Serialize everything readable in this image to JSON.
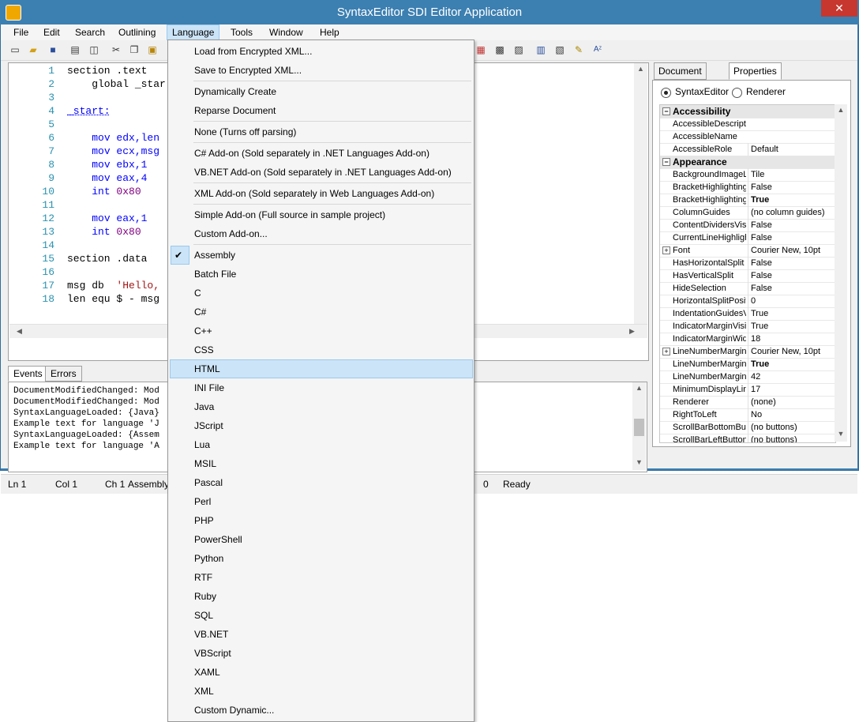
{
  "window": {
    "title": "SyntaxEditor SDI Editor Application",
    "close_glyph": "✕"
  },
  "menu": [
    "File",
    "Edit",
    "Search",
    "Outlining",
    "Language",
    "Tools",
    "Window",
    "Help"
  ],
  "code": {
    "line_numbers": [
      "1",
      "2",
      "3",
      "4",
      "5",
      "6",
      "7",
      "8",
      "9",
      "10",
      "11",
      "12",
      "13",
      "14",
      "15",
      "16",
      "17",
      "18"
    ],
    "lines": [
      {
        "t": "section .text",
        "c": ""
      },
      {
        "t": "    global _star",
        "c": ""
      },
      {
        "t": "",
        "c": ""
      },
      {
        "t": "_start:",
        "c": "lbl"
      },
      {
        "t": "",
        "c": ""
      },
      {
        "t": "    mov edx,len",
        "c": "mov"
      },
      {
        "t": "    mov ecx,msg",
        "c": "mov"
      },
      {
        "t": "    mov ebx,1",
        "c": "mov"
      },
      {
        "t": "    mov eax,4",
        "c": "mov"
      },
      {
        "t": "    int 0x80",
        "c": "int"
      },
      {
        "t": "",
        "c": ""
      },
      {
        "t": "    mov eax,1",
        "c": "mov"
      },
      {
        "t": "    int 0x80",
        "c": "int"
      },
      {
        "t": "",
        "c": ""
      },
      {
        "t": "section .data",
        "c": ""
      },
      {
        "t": "",
        "c": ""
      },
      {
        "t": "msg db  'Hello,",
        "c": "str"
      },
      {
        "t": "len equ $ - msg",
        "c": ""
      }
    ]
  },
  "bottom_tabs": [
    "Events",
    "Errors"
  ],
  "events": [
    "DocumentModifiedChanged: Mod",
    "DocumentModifiedChanged: Mod",
    "SyntaxLanguageLoaded: {Java}",
    "Example text for language 'J",
    "SyntaxLanguageLoaded: {Assem",
    "Example text for language 'A"
  ],
  "status": {
    "ln": "Ln 1",
    "col": "Col 1",
    "ch": "Ch 1",
    "lang": "Assembly",
    "zero": "0",
    "ready": "Ready"
  },
  "right_panel": {
    "tabs": [
      "Document Outline",
      "Properties"
    ],
    "radio_editor": "SyntaxEditor",
    "radio_renderer": "Renderer",
    "rows": [
      {
        "cat": "Accessibility"
      },
      {
        "n": "AccessibleDescripti",
        "v": ""
      },
      {
        "n": "AccessibleName",
        "v": ""
      },
      {
        "n": "AccessibleRole",
        "v": "Default"
      },
      {
        "cat": "Appearance"
      },
      {
        "n": "BackgroundImageL",
        "v": "Tile"
      },
      {
        "n": "BracketHighlighting",
        "v": "False"
      },
      {
        "n": "BracketHighlighting",
        "v": "True",
        "b": true
      },
      {
        "n": "ColumnGuides",
        "v": "(no column guides)"
      },
      {
        "n": "ContentDividersVisi",
        "v": "False"
      },
      {
        "n": "CurrentLineHighligh",
        "v": "False"
      },
      {
        "n": "Font",
        "v": "Courier New, 10pt",
        "exp": true
      },
      {
        "n": "HasHorizontalSplit",
        "v": "False"
      },
      {
        "n": "HasVerticalSplit",
        "v": "False"
      },
      {
        "n": "HideSelection",
        "v": "False"
      },
      {
        "n": "HorizontalSplitPositi",
        "v": "0"
      },
      {
        "n": "IndentationGuidesV",
        "v": "True"
      },
      {
        "n": "IndicatorMarginVisit",
        "v": "True"
      },
      {
        "n": "IndicatorMarginWid",
        "v": "18"
      },
      {
        "n": "LineNumberMarginI",
        "v": "Courier New, 10pt",
        "exp": true
      },
      {
        "n": "LineNumberMarginV",
        "v": "True",
        "b": true
      },
      {
        "n": "LineNumberMarginV",
        "v": "42"
      },
      {
        "n": "MinimumDisplayLine",
        "v": "17"
      },
      {
        "n": "Renderer",
        "v": "(none)"
      },
      {
        "n": "RightToLeft",
        "v": "No"
      },
      {
        "n": "ScrollBarBottomBut",
        "v": "(no buttons)"
      },
      {
        "n": "ScrollBarLeftButton",
        "v": "(no buttons)"
      }
    ]
  },
  "dropdown": {
    "group1": [
      "Load from Encrypted XML...",
      "Save to Encrypted XML..."
    ],
    "group2": [
      "Dynamically Create",
      "Reparse Document"
    ],
    "group3": [
      "None (Turns off parsing)"
    ],
    "group4": [
      "C# Add-on (Sold separately in .NET Languages Add-on)",
      "VB.NET Add-on (Sold separately in .NET Languages Add-on)"
    ],
    "group5": [
      "XML Add-on (Sold separately in Web Languages Add-on)"
    ],
    "group6": [
      "Simple Add-on (Full source in sample project)",
      "Custom Add-on..."
    ],
    "languages": [
      "Assembly",
      "Batch File",
      "C",
      "C#",
      "C++",
      "CSS",
      "HTML",
      "INI File",
      "Java",
      "JScript",
      "Lua",
      "MSIL",
      "Pascal",
      "Perl",
      "PHP",
      "PowerShell",
      "Python",
      "RTF",
      "Ruby",
      "SQL",
      "VB.NET",
      "VBScript",
      "XAML",
      "XML",
      "Custom Dynamic..."
    ],
    "checked": "Assembly",
    "highlighted": "HTML",
    "check_glyph": "✔"
  }
}
